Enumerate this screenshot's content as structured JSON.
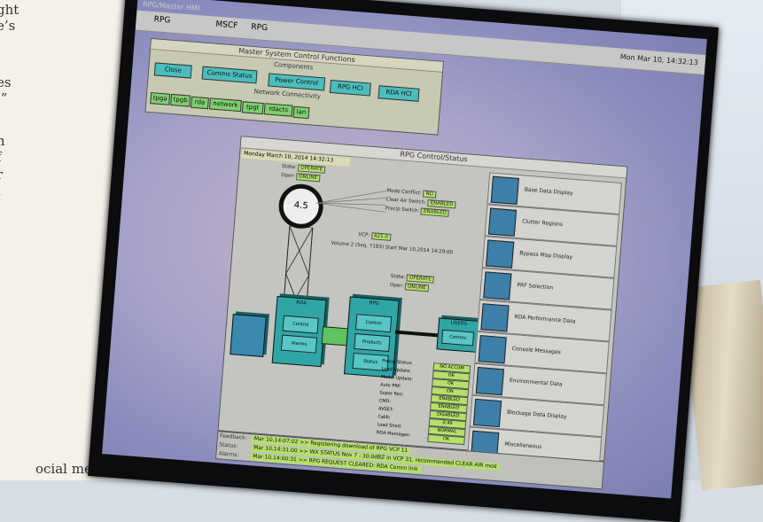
{
  "left_page": {
    "lines": [
      "ght",
      "e’s",
      "",
      "es",
      ",”",
      "",
      "n",
      "f",
      "r",
      "l",
      "",
      "",
      "",
      "",
      "",
      "",
      "",
      "",
      "",
      "",
      "",
      "",
      "",
      "",
      "ocial media has made"
    ]
  },
  "screen": {
    "title": "RPG/Master HMI",
    "top_bar_items": [
      "RPG",
      "MSCF",
      "RPG"
    ],
    "clock": "Mon Mar 10, 14:32:13",
    "msc_window": {
      "title": "Master System Control Functions",
      "components_label": "Components",
      "buttons": [
        "Close",
        "Comms Status",
        "Power Control",
        "RPG HCI",
        "RDA HCI"
      ],
      "network_label": "Network Connectivity",
      "network_buttons": [
        "tpga",
        "tpgb",
        "rda",
        "network",
        "tpgt",
        "rdacts",
        "lan"
      ]
    },
    "rpg_window": {
      "title": "RPG Control/Status",
      "date": "Monday March 10, 2014  14:32:13",
      "state_label": "State:",
      "state_value": "OPERATE",
      "oper_label": "Oper:",
      "oper_value": "ONLINE",
      "mode_conflict_label": "Mode Conflict:",
      "mode_conflict_value": "NO",
      "clear_air_label": "Clear Air Switch:",
      "clear_air_value": "ENABLED",
      "precip_label": "Precip Switch:",
      "precip_value": "ENABLED",
      "vcp_label": "VCP:",
      "vcp_value": "A21.0",
      "volume_text": "Volume 2 (Seq. 7183) Start Mar 10,2014 14:29:00",
      "dish_value": "4.5",
      "rda_box": "RDA",
      "rda_state_label": "State:",
      "rda_state_value": "OPERATE",
      "rda_oper_label": "Oper:",
      "rda_oper_value": "ONLINE",
      "rpg_box": "RPG",
      "users_box": "USERS",
      "box_rda_subs": [
        "Control",
        "Alarms"
      ],
      "box_rpg_subs": [
        "Control",
        "Products",
        "Status"
      ],
      "box_users_subs": [
        "Comms"
      ],
      "right_panel": [
        "Base Data Display",
        "Clutter Regions",
        "Bypass Map Display",
        "PRF Selection",
        "RDA Performance Data",
        "Console Messages",
        "Environmental Data",
        "Blockage Data Display",
        "Miscellaneous"
      ],
      "status_table": [
        {
          "label": "Precip Status:",
          "value": "NO ACCUM"
        },
        {
          "label": "Load Update:",
          "value": "OK"
        },
        {
          "label": "Model Update:",
          "value": "OK"
        },
        {
          "label": "Auto PRF:",
          "value": "ON"
        },
        {
          "label": "Super Res:",
          "value": "ENABLED"
        },
        {
          "label": "CMD:",
          "value": "ENABLED"
        },
        {
          "label": "AVSET:",
          "value": "DISABLED"
        },
        {
          "label": "Calib:",
          "value": "0.49"
        },
        {
          "label": "Load Shed:",
          "value": "NORMAL"
        },
        {
          "label": "RDA Messages:",
          "value": "OK"
        }
      ],
      "feedback_label": "Feedback:",
      "feedback_text": "Mar 10,14:07:02 >> Registering download of RPG VCP 11",
      "status_label": "Status:",
      "status_text": "Mar 10,14:31:00 >> WX STATUS   Nov 7 : 30.0dBZ in VCP 31, recommended CLEAR AIR mod",
      "alarms_label": "Alarms:",
      "alarms_text": "Mar 10,14:00:31 >> RPG REQUEST CLEARED: RDA Comm link"
    }
  },
  "colors": {
    "cyan_button": "#4bbdbd",
    "green_field": "#b5e06a",
    "window_bg": "#c4c4c0"
  }
}
